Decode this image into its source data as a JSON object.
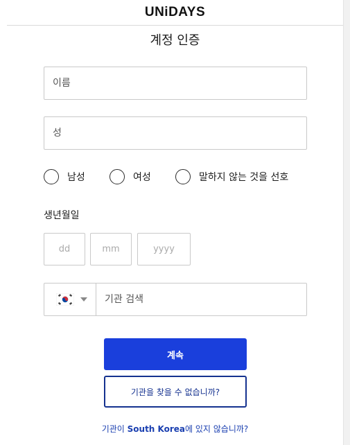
{
  "header": {
    "logo": "UNiDAYS"
  },
  "page": {
    "title": "계정 인증"
  },
  "form": {
    "first_name": {
      "placeholder": "이름",
      "value": ""
    },
    "last_name": {
      "placeholder": "성",
      "value": ""
    },
    "gender": {
      "options": [
        {
          "label": "남성",
          "selected": false
        },
        {
          "label": "여성",
          "selected": false
        },
        {
          "label": "말하지 않는 것을 선호",
          "selected": false
        }
      ]
    },
    "dob": {
      "label": "생년월일",
      "day_placeholder": "dd",
      "month_placeholder": "mm",
      "year_placeholder": "yyyy"
    },
    "institution": {
      "country_flag_icon": "south-korea-flag-icon",
      "search_placeholder": "기관 검색"
    }
  },
  "actions": {
    "continue_label": "계속",
    "not_found_label": "기관을 찾을 수 없습니까?",
    "country_prefix": "기관이 ",
    "country_name": "South Korea",
    "country_suffix": "에 있지 않습니까?"
  },
  "colors": {
    "primary": "#1a3fdc",
    "secondary_border": "#14318f",
    "link": "#1a3fb0"
  }
}
